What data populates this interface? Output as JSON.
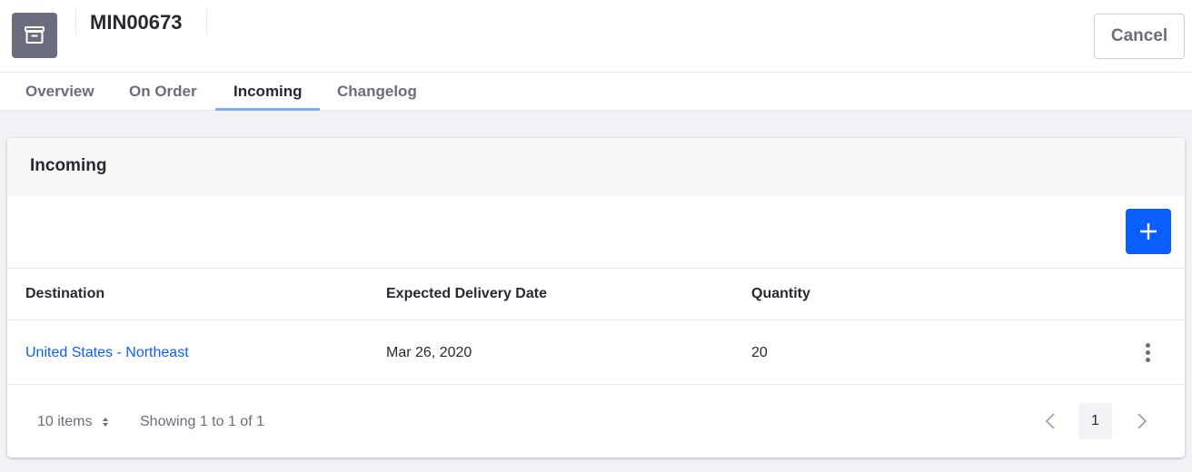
{
  "header": {
    "icon": "archive-box-icon",
    "title": "MIN00673",
    "cancel_label": "Cancel"
  },
  "tabs": [
    {
      "label": "Overview",
      "active": false
    },
    {
      "label": "On Order",
      "active": false
    },
    {
      "label": "Incoming",
      "active": true
    },
    {
      "label": "Changelog",
      "active": false
    }
  ],
  "card": {
    "title": "Incoming",
    "add_icon": "plus-icon",
    "columns": [
      "Destination",
      "Expected Delivery Date",
      "Quantity"
    ],
    "rows": [
      {
        "destination": "United States - Northeast",
        "date": "Mar 26, 2020",
        "quantity": "20",
        "actions_icon": "kebab-menu-icon"
      }
    ],
    "footer": {
      "page_size": "10 items",
      "showing": "Showing 1 to 1 of 1",
      "current_page": "1"
    }
  },
  "colors": {
    "primary": "#0b5fff",
    "tab_indicator": "#80acff",
    "icon_bg": "#6b6c7e"
  }
}
